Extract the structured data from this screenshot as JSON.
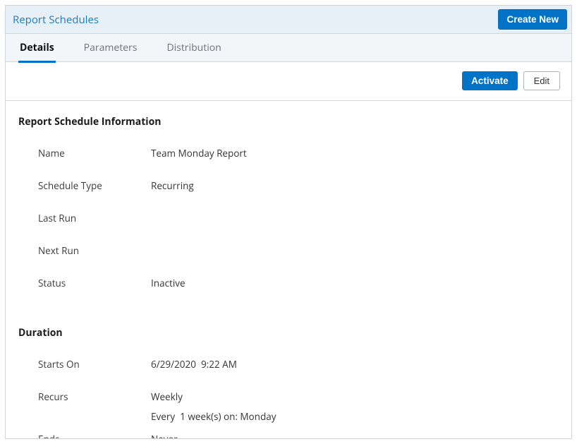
{
  "header": {
    "title": "Report Schedules",
    "create_new": "Create New"
  },
  "tabs": {
    "details": "Details",
    "parameters": "Parameters",
    "distribution": "Distribution"
  },
  "actions": {
    "activate": "Activate",
    "edit": "Edit"
  },
  "sections": {
    "info_title": "Report Schedule Information",
    "duration_title": "Duration"
  },
  "info": {
    "name_label": "Name",
    "name_value": "Team Monday Report",
    "schedule_type_label": "Schedule Type",
    "schedule_type_value": "Recurring",
    "last_run_label": "Last Run",
    "last_run_value": "",
    "next_run_label": "Next Run",
    "next_run_value": "",
    "status_label": "Status",
    "status_value": "Inactive"
  },
  "duration": {
    "starts_on_label": "Starts On",
    "starts_on_value": "6/29/2020  9:22 AM",
    "recurs_label": "Recurs",
    "recurs_value": "Weekly",
    "recurs_detail": "Every  1 week(s) on: Monday",
    "ends_label": "Ends",
    "ends_value": "Never"
  }
}
